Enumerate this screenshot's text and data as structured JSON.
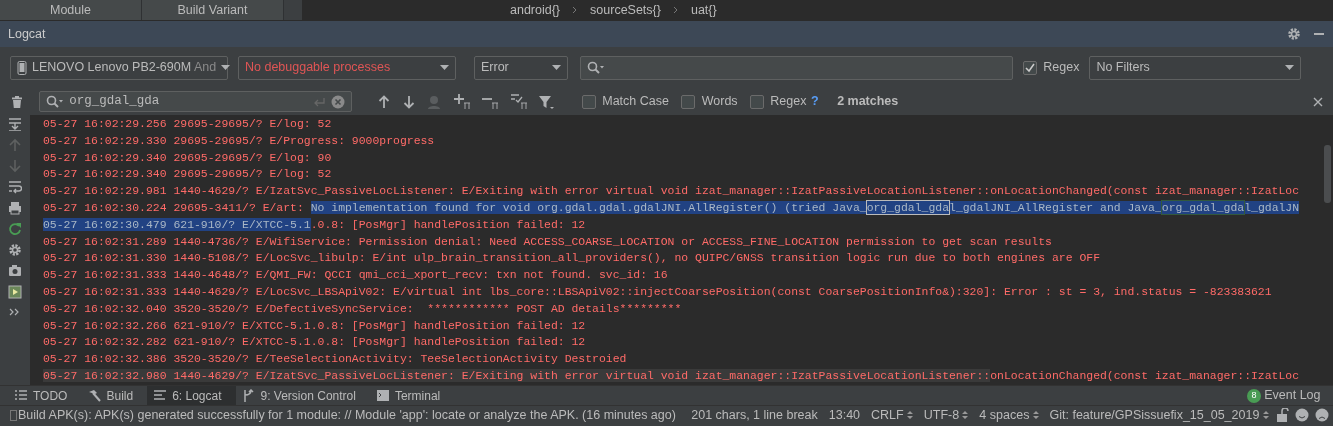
{
  "top_bar": {
    "tabs": [
      "Module",
      "Build Variant"
    ],
    "breadcrumb": [
      "android{}",
      "sourceSets{}",
      "uat{}"
    ]
  },
  "panel": {
    "title": "Logcat"
  },
  "filters": {
    "device": {
      "value": "LENOVO Lenovo PB2-690M",
      "suffix": "And"
    },
    "process": {
      "value": "No debuggable processes"
    },
    "level": {
      "value": "Error"
    },
    "regex": {
      "label": "Regex",
      "checked": true
    },
    "filter": {
      "value": "No Filters"
    }
  },
  "find": {
    "value": "org_gdal_gda",
    "options": [
      {
        "label": "Match Case",
        "checked": false
      },
      {
        "label": "Words",
        "checked": false
      },
      {
        "label": "Regex",
        "checked": false
      }
    ],
    "help": "?",
    "matches": "2 matches"
  },
  "log_lines": [
    {
      "segments": [
        {
          "kind": "plain",
          "text": "05-27 16:02:29.256 29695-29695/? E/log: 52"
        }
      ]
    },
    {
      "segments": [
        {
          "kind": "plain",
          "text": "05-27 16:02:29.330 29695-29695/? E/Progress: 9000progress"
        }
      ]
    },
    {
      "segments": [
        {
          "kind": "plain",
          "text": "05-27 16:02:29.340 29695-29695/? E/log: 90"
        }
      ]
    },
    {
      "segments": [
        {
          "kind": "plain",
          "text": "05-27 16:02:29.340 29695-29695/? E/log: 52"
        }
      ]
    },
    {
      "segments": [
        {
          "kind": "plain",
          "text": "05-27 16:02:29.981 1440-4629/? E/IzatSvc_PassiveLocListener: E/Exiting with error virtual void izat_manager::IzatPassiveLocationListener::onLocationChanged(const izat_manager::IzatLoc"
        }
      ]
    },
    {
      "segments": [
        {
          "kind": "plain",
          "text": "05-27 16:02:30.224 29695-3411/? E/art: "
        },
        {
          "kind": "selected",
          "text": "No implementation found for void org.gdal.gdal.gdalJNI.AllRegister() (tried Java_"
        },
        {
          "kind": "current_match",
          "text": "org_gdal_gda"
        },
        {
          "kind": "selected",
          "text": "l_gdalJNI_AllRegister and Java_"
        },
        {
          "kind": "match",
          "text": "org_gdal_gda"
        },
        {
          "kind": "selected",
          "text": "l_gdalJN"
        }
      ]
    },
    {
      "segments": [
        {
          "kind": "selected",
          "text": "05-27 16:02:30.479 621-910/? E/XTCC-5.1"
        },
        {
          "kind": "plain",
          "text": ".0.8: [PosMgr] handlePosition failed: 12"
        }
      ]
    },
    {
      "segments": [
        {
          "kind": "plain",
          "text": "05-27 16:02:31.289 1440-4736/? E/WifiService: Permission denial: Need ACCESS_COARSE_LOCATION or ACCESS_FINE_LOCATION permission to get scan results"
        }
      ]
    },
    {
      "segments": [
        {
          "kind": "plain",
          "text": "05-27 16:02:31.330 1440-5108/? E/LocSvc_libulp: E/int ulp_brain_transition_all_providers(), no QUIPC/GNSS transition logic run due to both engines are OFF"
        }
      ]
    },
    {
      "segments": [
        {
          "kind": "plain",
          "text": "05-27 16:02:31.333 1440-4648/? E/QMI_FW: QCCI qmi_cci_xport_recv: txn not found. svc_id: 16"
        }
      ]
    },
    {
      "segments": [
        {
          "kind": "plain",
          "text": "05-27 16:02:31.333 1440-4629/? E/LocSvc_LBSApiV02: E/virtual int lbs_core::LBSApiV02::injectCoarsePosition(const CoarsePositionInfo&):320]: Error : st = 3, ind.status = -823383621"
        }
      ]
    },
    {
      "segments": [
        {
          "kind": "plain",
          "text": "05-27 16:02:32.040 3520-3520/? E/DefectiveSyncService:  ************ POST AD details*********"
        }
      ]
    },
    {
      "segments": [
        {
          "kind": "plain",
          "text": "05-27 16:02:32.266 621-910/? E/XTCC-5.1.0.8: [PosMgr] handlePosition failed: 12"
        }
      ]
    },
    {
      "segments": [
        {
          "kind": "plain",
          "text": "05-27 16:02:32.282 621-910/? E/XTCC-5.1.0.8: [PosMgr] handlePosition failed: 12"
        }
      ]
    },
    {
      "segments": [
        {
          "kind": "plain",
          "text": "05-27 16:02:32.386 3520-3520/? E/TeeSelectionActivity: TeeSelectionActivity Destroied"
        }
      ]
    },
    {
      "segments": [
        {
          "kind": "hover",
          "text": "05-27 16:02:32.980 1440-4629/? E/IzatSvc_PassiveLocListener: E/Exiting with error virtual void izat_manager::IzatPassiveLocationListener::"
        },
        {
          "kind": "plain",
          "text": "onLocationChanged(const izat_manager::IzatLoc"
        }
      ]
    }
  ],
  "tool_tabs": [
    {
      "label": "TODO",
      "selected": false
    },
    {
      "label": "Build",
      "selected": false
    },
    {
      "label": "6: Logcat",
      "selected": true
    },
    {
      "label": "9: Version Control",
      "selected": false
    },
    {
      "label": "Terminal",
      "selected": false
    }
  ],
  "event_log": {
    "count": "8",
    "label": "Event Log"
  },
  "status_bar": {
    "message": "Build APK(s): APK(s) generated successfully for 1 module: // Module 'app': locate or analyze the APK. (16 minutes ago)",
    "items": [
      {
        "text": "201 chars, 1 line break",
        "kind": "text"
      },
      {
        "text": "13:40",
        "kind": "text"
      },
      {
        "text": "CRLF",
        "kind": "select"
      },
      {
        "text": "UTF-8",
        "kind": "select"
      },
      {
        "text": "4 spaces",
        "kind": "select"
      },
      {
        "text": "Git: feature/GPSissuefix_15_05_2019",
        "kind": "select"
      }
    ]
  }
}
